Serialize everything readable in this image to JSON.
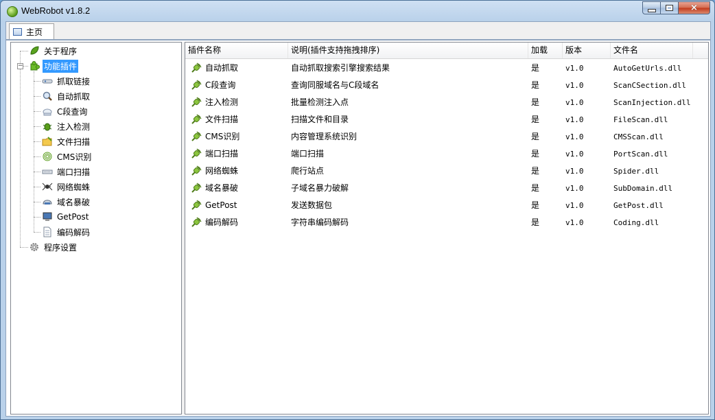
{
  "window": {
    "title": "WebRobot v1.8.2"
  },
  "caption_buttons": {
    "minimize": "minimize",
    "maximize": "maximize",
    "close": "×"
  },
  "tabs": [
    {
      "label": "主页"
    }
  ],
  "tree": {
    "about": "关于程序",
    "plugins": "功能插件",
    "plugin_items": [
      "抓取链接",
      "自动抓取",
      "C段查询",
      "注入检测",
      "文件扫描",
      "CMS识别",
      "端口扫描",
      "网络蜘蛛",
      "域名暴破",
      "GetPost",
      "编码解码"
    ],
    "settings": "程序设置",
    "plugins_expander": "−"
  },
  "table": {
    "columns": [
      "插件名称",
      "说明(插件支持拖拽排序)",
      "加载",
      "版本",
      "文件名"
    ],
    "rows": [
      {
        "name": "自动抓取",
        "desc": "自动抓取搜索引擎搜索结果",
        "loaded": "是",
        "version": "v1.0",
        "file": "AutoGetUrls.dll"
      },
      {
        "name": "C段查询",
        "desc": "查询同服域名与C段域名",
        "loaded": "是",
        "version": "v1.0",
        "file": "ScanCSection.dll"
      },
      {
        "name": "注入检测",
        "desc": "批量检测注入点",
        "loaded": "是",
        "version": "v1.0",
        "file": "ScanInjection.dll"
      },
      {
        "name": "文件扫描",
        "desc": "扫描文件和目录",
        "loaded": "是",
        "version": "v1.0",
        "file": "FileScan.dll"
      },
      {
        "name": "CMS识别",
        "desc": "内容管理系统识别",
        "loaded": "是",
        "version": "v1.0",
        "file": "CMSScan.dll"
      },
      {
        "name": "端口扫描",
        "desc": "端口扫描",
        "loaded": "是",
        "version": "v1.0",
        "file": "PortScan.dll"
      },
      {
        "name": "网络蜘蛛",
        "desc": "爬行站点",
        "loaded": "是",
        "version": "v1.0",
        "file": "Spider.dll"
      },
      {
        "name": "域名暴破",
        "desc": "子域名暴力破解",
        "loaded": "是",
        "version": "v1.0",
        "file": "SubDomain.dll"
      },
      {
        "name": "GetPost",
        "desc": "发送数据包",
        "loaded": "是",
        "version": "v1.0",
        "file": "GetPost.dll"
      },
      {
        "name": "编码解码",
        "desc": "字符串编码解码",
        "loaded": "是",
        "version": "v1.0",
        "file": "Coding.dll"
      }
    ]
  },
  "colors": {
    "selection": "#3399ff",
    "titlebar": "#b9d1ea",
    "plugin_green": "#5a9d1c"
  }
}
